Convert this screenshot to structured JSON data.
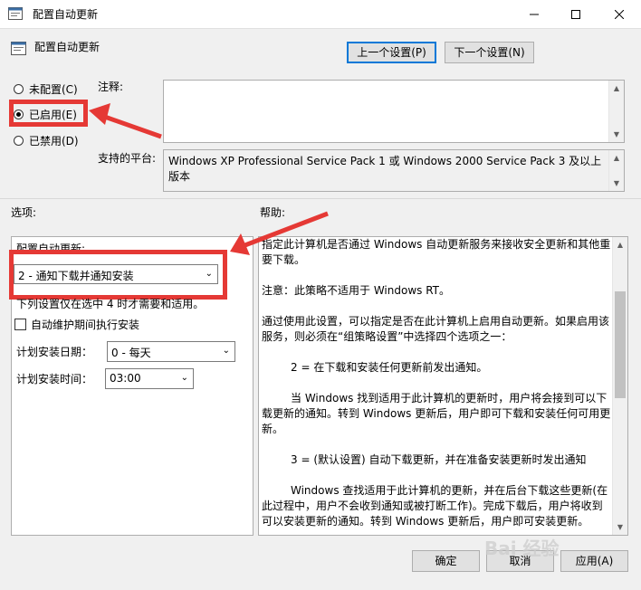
{
  "window": {
    "title": "配置自动更新"
  },
  "header": {
    "title": "配置自动更新",
    "prev_button": "上一个设置(P)",
    "next_button": "下一个设置(N)"
  },
  "radios": {
    "unconfigured": "未配置(C)",
    "enabled": "已启用(E)",
    "disabled": "已禁用(D)",
    "selected": "enabled"
  },
  "comment": {
    "label": "注释:",
    "value": ""
  },
  "platform": {
    "label": "支持的平台:",
    "value": "Windows XP Professional Service Pack 1 或 Windows 2000 Service Pack 3 及以上版本"
  },
  "options": {
    "label": "选项:",
    "config_label": "配置自动更新:",
    "update_mode": "2 - 通知下载并通知安装",
    "note": "下列设置仅在选中 4 时才需要和适用。",
    "maintenance_checkbox": "自动维护期间执行安装",
    "day_label": "计划安装日期：",
    "day_value": "0 - 每天",
    "time_label": "计划安装时间：",
    "time_value": "03:00"
  },
  "help": {
    "label": "帮助:",
    "paragraphs": [
      "指定此计算机是否通过 Windows 自动更新服务来接收安全更新和其他重要下载。",
      "注意：此策略不适用于 Windows RT。",
      "通过使用此设置，可以指定是否在此计算机上启用自动更新。如果启用该服务，则必须在“组策略设置”中选择四个选项之一：",
      "2 = 在下载和安装任何更新前发出通知。",
      "当 Windows 找到适用于此计算机的更新时，用户将会接到可以下载更新的通知。转到 Windows 更新后，用户即可下载和安装任何可用更新。",
      "3 = (默认设置) 自动下载更新，并在准备安装更新时发出通知",
      "Windows 查找适用于此计算机的更新，并在后台下载这些更新(在此过程中，用户不会收到通知或被打断工作)。完成下载后，用户将收到可以安装更新的通知。转到 Windows 更新后，用户即可安装更新。"
    ]
  },
  "footer": {
    "ok": "确定",
    "cancel": "取消",
    "apply": "应用(A)"
  },
  "watermark": "Bai 经验",
  "colors": {
    "annotation_red": "#e53935",
    "focus_blue": "#0078d7"
  }
}
